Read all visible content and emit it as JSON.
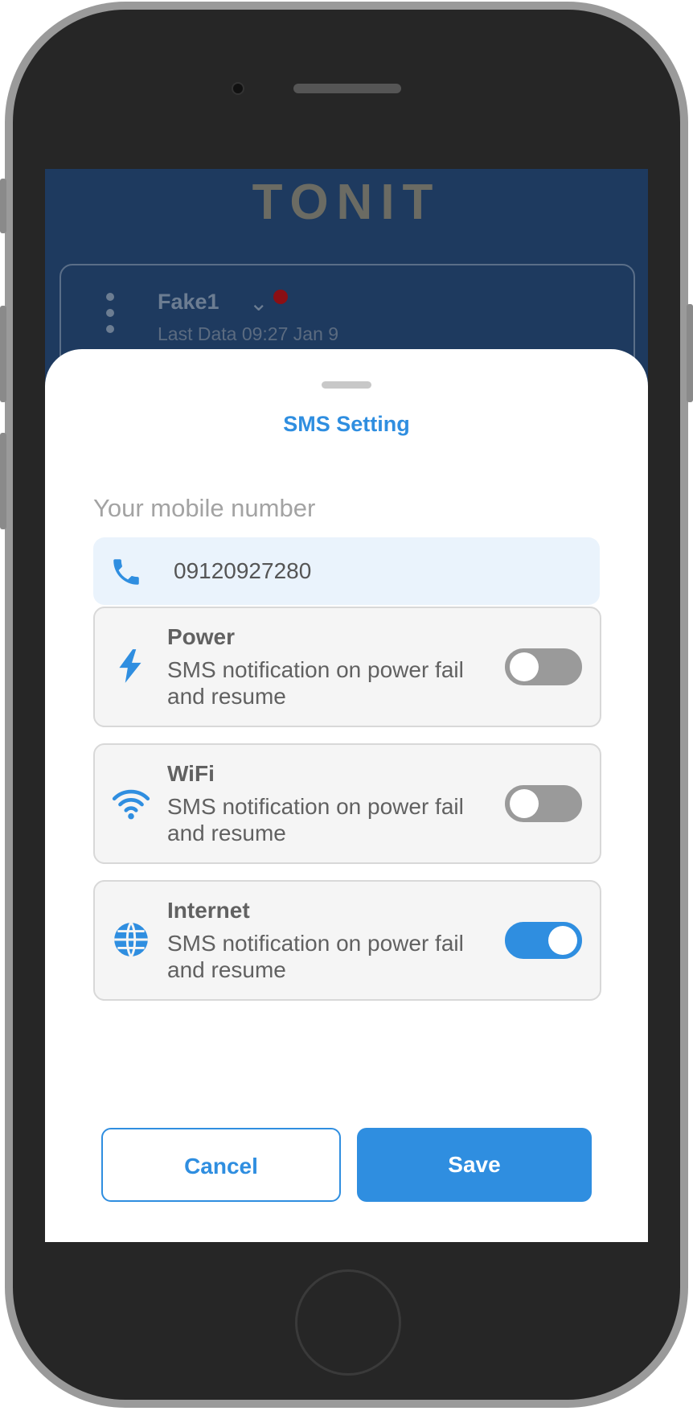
{
  "background": {
    "logo": "TONIT",
    "device_name": "Fake1",
    "last_data": "Last Data 09:27 Jan 9"
  },
  "sheet": {
    "title": "SMS Setting",
    "mobile_label": "Your mobile number",
    "mobile_value": "09120927280",
    "options": [
      {
        "title": "Power",
        "description": "SMS notification on power fail and resume",
        "icon": "lightning-icon",
        "enabled": false
      },
      {
        "title": "WiFi",
        "description": "SMS notification on power fail and resume",
        "icon": "wifi-icon",
        "enabled": false
      },
      {
        "title": "Internet",
        "description": "SMS notification on power fail and resume",
        "icon": "globe-icon",
        "enabled": true
      }
    ],
    "cancel_label": "Cancel",
    "save_label": "Save"
  },
  "colors": {
    "accent": "#2f8ee0",
    "overlay_bg": "#1e3a5f",
    "toggle_off": "#9a9a9a"
  }
}
